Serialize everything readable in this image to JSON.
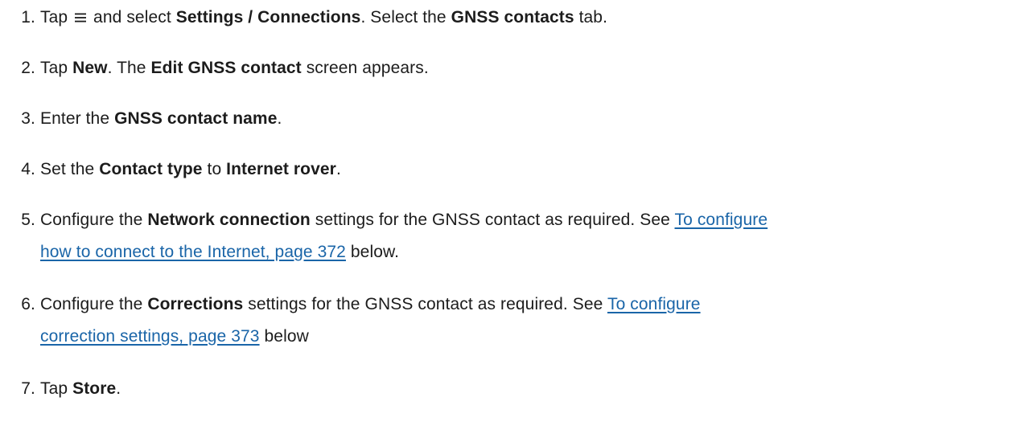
{
  "steps": [
    {
      "number": "1.",
      "parts": {
        "a": "Tap",
        "menu_icon": "menu-icon",
        "b": "and select",
        "c": "Settings / Connections",
        "d": ". Select the",
        "e": "GNSS contacts",
        "f": "tab."
      }
    },
    {
      "number": "2.",
      "parts": {
        "a": "Tap",
        "b": "New",
        "c": ". The",
        "d": "Edit GNSS contact",
        "e": "screen appears."
      }
    },
    {
      "number": "3.",
      "parts": {
        "a": "Enter the",
        "b": "GNSS contact name",
        "c": "."
      }
    },
    {
      "number": "4.",
      "parts": {
        "a": "Set the",
        "b": "Contact type",
        "c": "to",
        "d": "Internet rover",
        "e": "."
      }
    },
    {
      "number": "5.",
      "parts": {
        "a": "Configure the",
        "b": "Network connection",
        "c": "settings for the GNSS contact as required. See",
        "link_line1": "To configure",
        "link_line2": "how to connect to the Internet, page 372",
        "d": "below."
      }
    },
    {
      "number": "6.",
      "parts": {
        "a": "Configure the",
        "b": "Corrections",
        "c": "settings for the GNSS contact as required. See",
        "link_line1": "To configure",
        "link_line2": "correction settings, page 373",
        "d": "below"
      }
    },
    {
      "number": "7.",
      "parts": {
        "a": "Tap",
        "b": "Store",
        "c": "."
      }
    }
  ],
  "colors": {
    "text": "#1c1c1c",
    "link": "#1a65a8"
  }
}
